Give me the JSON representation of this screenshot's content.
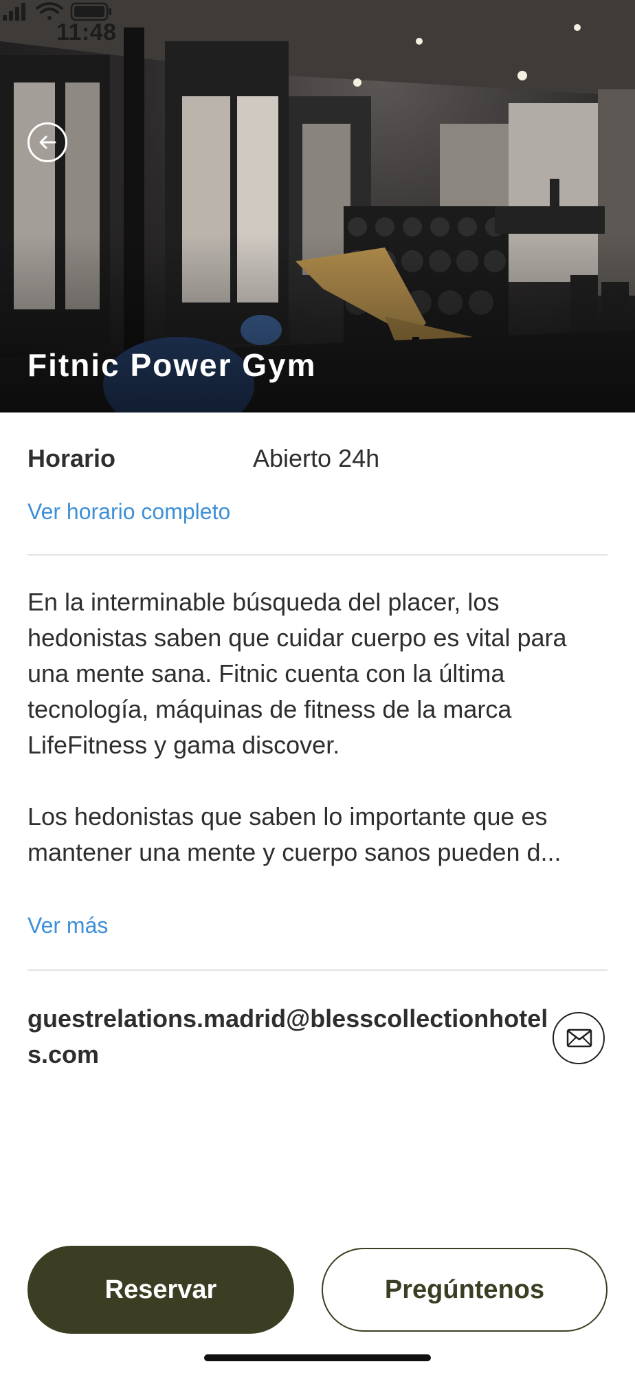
{
  "status_bar": {
    "time": "11:48",
    "icons": [
      "signal-icon",
      "wifi-icon",
      "battery-icon"
    ]
  },
  "hero": {
    "title": "Fitnic Power Gym",
    "back_icon": "back-arrow-icon"
  },
  "schedule": {
    "label": "Horario",
    "value": "Abierto 24h",
    "link": "Ver horario completo"
  },
  "description": {
    "paragraph1": "En la interminable búsqueda del placer, los hedonistas saben que cuidar cuerpo es vital para una mente sana. Fitnic cuenta con la última tecnología, máquinas de fitness de la marca LifeFitness y gama discover.",
    "paragraph2": "Los hedonistas que saben lo importante que es mantener una mente y cuerpo sanos pueden d...",
    "more_link": "Ver más"
  },
  "contact": {
    "email": "guestrelations.madrid@blesscollectionhotels.com",
    "mail_icon": "envelope-icon"
  },
  "actions": {
    "primary_label": "Reservar",
    "secondary_label": "Pregúntenos"
  },
  "colors": {
    "accent_dark_olive": "#3b3e22",
    "link_blue": "#3d8fd6",
    "text": "#2e2e2e",
    "divider": "#e3e3e3"
  }
}
